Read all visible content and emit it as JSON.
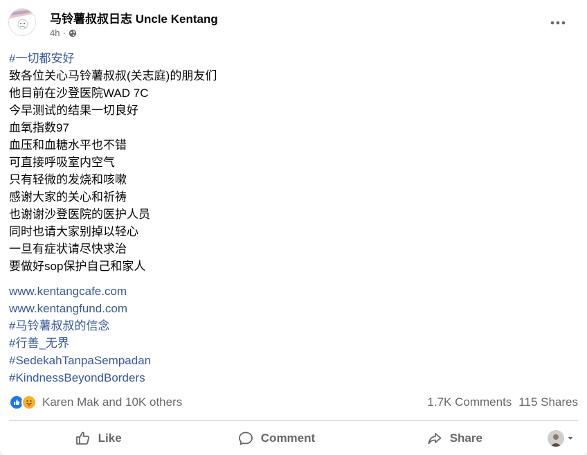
{
  "header": {
    "page_name": "马铃薯叔叔日志 Uncle Kentang",
    "time": "4h",
    "dot": "·",
    "privacy_icon": "globe-icon",
    "more_icon": "more-icon"
  },
  "post": {
    "hashtag_top": "#一切都安好",
    "lines": [
      "致各位关心马铃薯叔叔(关志庭)的朋友们",
      "他目前在沙登医院WAD 7C",
      "今早测试的结果一切良好",
      "血氧指数97",
      "血压和血糖水平也不错",
      "可直接呼吸室内空气",
      "只有轻微的发烧和咳嗽",
      "感谢大家的关心和祈祷",
      "也谢谢沙登医院的医护人员",
      "同时也请大家别掉以轻心",
      "一旦有症状请尽快求治",
      "要做好sop保护自己和家人"
    ],
    "links": [
      "www.kentangcafe.com",
      "www.kentangfund.com",
      "#马铃薯叔叔的信念",
      "#行善_无界",
      "#SedekahTanpaSempadan",
      "#KindnessBeyondBorders"
    ]
  },
  "reactions": {
    "icons": [
      "like-icon",
      "care-icon"
    ],
    "names": "Karen Mak and 10K others",
    "comments": "1.7K Comments",
    "shares": "115 Shares"
  },
  "actions": {
    "like_label": "Like",
    "comment_label": "Comment",
    "share_label": "Share"
  },
  "colors": {
    "link": "#385898",
    "muted": "#65676b",
    "like_blue": "#1877f2",
    "care_yellow": "#f7b125"
  }
}
